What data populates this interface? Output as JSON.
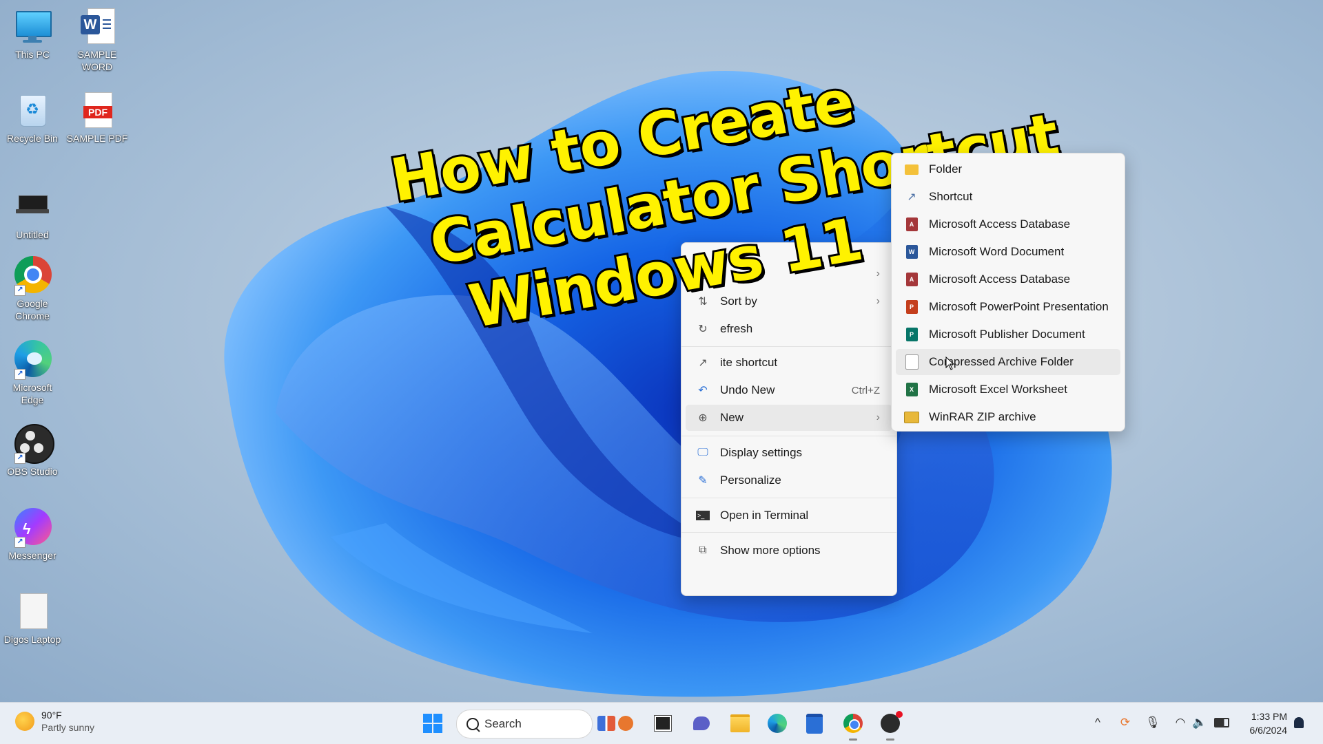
{
  "overlay_title": {
    "line1": "How to Create",
    "line2": "Calculator Shortcut",
    "line3": "Windows 11"
  },
  "desktop_icons": [
    {
      "label": "This PC",
      "icon": "monitor-icon"
    },
    {
      "label": "SAMPLE WORD",
      "icon": "word-doc-icon"
    },
    {
      "label": "Recycle Bin",
      "icon": "recycle-bin-icon"
    },
    {
      "label": "SAMPLE PDF",
      "icon": "pdf-icon",
      "badge": "PDF"
    },
    {
      "label": "Untitled",
      "icon": "laptop-icon"
    },
    {
      "label": "Google Chrome",
      "icon": "chrome-icon"
    },
    {
      "label": "Microsoft Edge",
      "icon": "edge-icon"
    },
    {
      "label": "OBS Studio",
      "icon": "obs-icon"
    },
    {
      "label": "Messenger",
      "icon": "messenger-icon"
    },
    {
      "label": "Digos Laptop",
      "icon": "blank-file-icon"
    }
  ],
  "context_menu": {
    "items": [
      {
        "label": "",
        "icon": "view-icon",
        "chevron": "›"
      },
      {
        "label": "Sort by",
        "icon": "sort-icon",
        "chevron": "›"
      },
      {
        "label": "efresh",
        "icon": "refresh-icon"
      },
      {
        "label": "ite shortcut",
        "icon": "shortcut-icon"
      },
      {
        "label": "Undo New",
        "icon": "undo-icon",
        "shortcut": "Ctrl+Z"
      },
      {
        "label": "New",
        "icon": "new-plus-icon",
        "chevron": "›"
      },
      {
        "label": "Display settings",
        "icon": "display-icon"
      },
      {
        "label": "Personalize",
        "icon": "brush-icon"
      },
      {
        "label": "Open in Terminal",
        "icon": "terminal-icon"
      },
      {
        "label": "Show more options",
        "icon": "more-options-icon"
      }
    ]
  },
  "new_submenu": {
    "items": [
      {
        "label": "Folder",
        "icon": "folder-icon",
        "color": "#f4c13a"
      },
      {
        "label": "Shortcut",
        "icon": "shortcut-arrow-icon",
        "color": "#4a6fa5"
      },
      {
        "label": "Microsoft Access Database",
        "icon": "access-icon",
        "color": "#a4373a"
      },
      {
        "label": "Microsoft Word Document",
        "icon": "word-icon",
        "color": "#2b579a"
      },
      {
        "label": "Microsoft Access Database",
        "icon": "access-icon",
        "color": "#a4373a"
      },
      {
        "label": "Microsoft PowerPoint Presentation",
        "icon": "powerpoint-icon",
        "color": "#c43e1c"
      },
      {
        "label": "Microsoft Publisher Document",
        "icon": "publisher-icon",
        "color": "#077568"
      },
      {
        "label": "Compressed Archive Folder",
        "icon": "blank-doc-icon",
        "color": "#ffffff"
      },
      {
        "label": "Microsoft Excel Worksheet",
        "icon": "excel-icon",
        "color": "#217346"
      },
      {
        "label": "WinRAR ZIP archive",
        "icon": "winrar-icon",
        "color": "#e8b83a"
      }
    ]
  },
  "taskbar": {
    "weather_temp": "90°F",
    "weather_desc": "Partly sunny",
    "search_label": "Search",
    "time": "1:33 PM",
    "date": "6/6/2024",
    "tray_chevron": "^"
  }
}
